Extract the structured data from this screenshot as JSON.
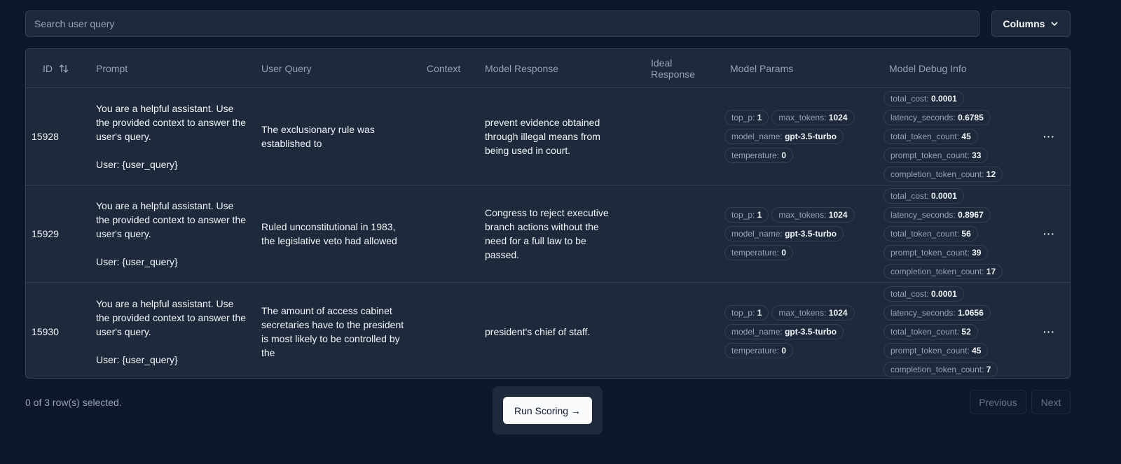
{
  "search": {
    "placeholder": "Search user query"
  },
  "columns_button": {
    "label": "Columns"
  },
  "headers": [
    "ID",
    "Prompt",
    "User Query",
    "Context",
    "Model Response",
    "Ideal Response",
    "Model Params",
    "Model Debug Info"
  ],
  "rows": [
    {
      "id": "15928",
      "prompt": "You are a helpful assistant. Use the provided context to answer the user's query.\n\nUser: {user_query}",
      "user_query": "The exclusionary rule was established to",
      "context": "",
      "model_response": " prevent evidence obtained through illegal means from being used in court.",
      "ideal_response": "",
      "params": [
        [
          "top_p:",
          "1"
        ],
        [
          "max_tokens:",
          "1024"
        ],
        [
          "model_name:",
          "gpt-3.5-turbo"
        ],
        [
          "temperature:",
          "0"
        ]
      ],
      "debug": [
        [
          "total_cost:",
          "0.0001"
        ],
        [
          "latency_seconds:",
          "0.6785"
        ],
        [
          "total_token_count:",
          "45"
        ],
        [
          "prompt_token_count:",
          "33"
        ],
        [
          "completion_token_count:",
          "12"
        ]
      ]
    },
    {
      "id": "15929",
      "prompt": "You are a helpful assistant. Use the provided context to answer the user's query.\n\nUser: {user_query}",
      "user_query": "Ruled unconstitutional in 1983, the legislative veto had allowed",
      "context": "",
      "model_response": " Congress to reject executive branch actions without the need for a full law to be passed.",
      "ideal_response": "",
      "params": [
        [
          "top_p:",
          "1"
        ],
        [
          "max_tokens:",
          "1024"
        ],
        [
          "model_name:",
          "gpt-3.5-turbo"
        ],
        [
          "temperature:",
          "0"
        ]
      ],
      "debug": [
        [
          "total_cost:",
          "0.0001"
        ],
        [
          "latency_seconds:",
          "0.8967"
        ],
        [
          "total_token_count:",
          "56"
        ],
        [
          "prompt_token_count:",
          "39"
        ],
        [
          "completion_token_count:",
          "17"
        ]
      ]
    },
    {
      "id": "15930",
      "prompt": "You are a helpful assistant. Use the provided context to answer the user's query.\n\nUser: {user_query}",
      "user_query": "The amount of access cabinet secretaries have to the president is most likely to be controlled by the",
      "context": "",
      "model_response": "president's chief of staff.",
      "ideal_response": "",
      "params": [
        [
          "top_p:",
          "1"
        ],
        [
          "max_tokens:",
          "1024"
        ],
        [
          "model_name:",
          "gpt-3.5-turbo"
        ],
        [
          "temperature:",
          "0"
        ]
      ],
      "debug": [
        [
          "total_cost:",
          "0.0001"
        ],
        [
          "latency_seconds:",
          "1.0656"
        ],
        [
          "total_token_count:",
          "52"
        ],
        [
          "prompt_token_count:",
          "45"
        ],
        [
          "completion_token_count:",
          "7"
        ]
      ]
    }
  ],
  "footer": {
    "selection": "0 of 3 row(s) selected.",
    "run_scoring": "Run Scoring →",
    "previous": "Previous",
    "next": "Next"
  },
  "icons": {
    "sort": "arrow-up-down-icon",
    "columns": "chevron-down-icon",
    "row_actions": "more-horizontal-icon"
  }
}
